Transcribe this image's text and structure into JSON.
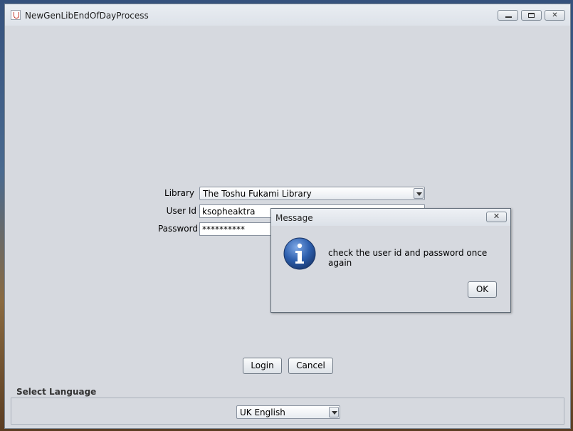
{
  "window": {
    "title": "NewGenLibEndOfDayProcess",
    "controls": {
      "minimize": "minimize",
      "maximize": "maximize",
      "close": "✕"
    }
  },
  "login_form": {
    "library_label": "Library",
    "library_value": "The Toshu Fukami Library",
    "userid_label": "User Id",
    "userid_value": "ksopheaktra",
    "password_label": "Password",
    "password_value": "**********"
  },
  "buttons": {
    "login": "Login",
    "cancel": "Cancel"
  },
  "language": {
    "section_title": "Select Language",
    "selected": "UK English"
  },
  "dialog": {
    "title": "Message",
    "message": "check the user id and password once again",
    "ok": "OK",
    "icon": "info-icon"
  },
  "colors": {
    "window_bg": "#d6d9df",
    "info_blue": "#2d5fae"
  }
}
